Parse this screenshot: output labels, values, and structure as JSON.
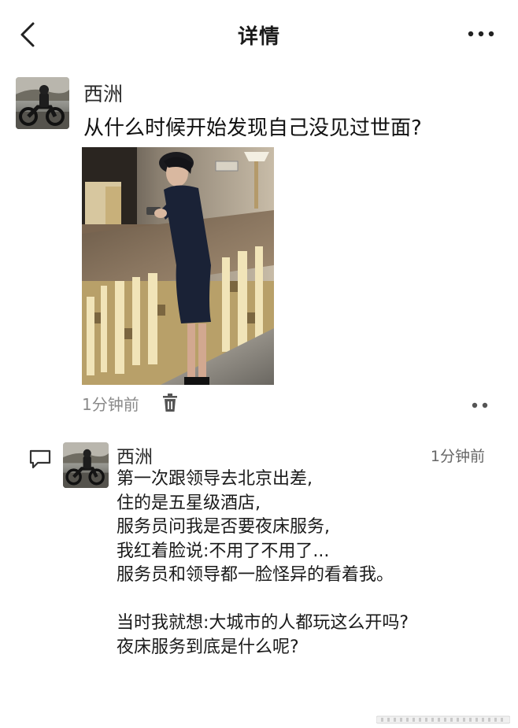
{
  "header": {
    "title": "详情",
    "back_icon": "chevron-left-icon",
    "more_icon": "more-horizontal-icon"
  },
  "post": {
    "author": "西洲",
    "text": "从什么时候开始发现自己没见过世面?",
    "time": "1分钟前",
    "trash_icon": "trash-icon",
    "more_icon": "more-dots-icon"
  },
  "comment": {
    "author": "西洲",
    "time": "1分钟前",
    "lines": [
      "第一次跟领导去北京出差,",
      "住的是五星级酒店,",
      "服务员问我是否要夜床服务,",
      "我红着脸说:不用了不用了...",
      "服务员和领导都一脸怪异的看着我。",
      "",
      "当时我就想:大城市的人都玩这么开吗?",
      "夜床服务到底是什么呢?"
    ]
  },
  "colors": {
    "text_primary": "#1a1a1a",
    "text_secondary": "#8a8a8a",
    "background": "#ffffff"
  }
}
